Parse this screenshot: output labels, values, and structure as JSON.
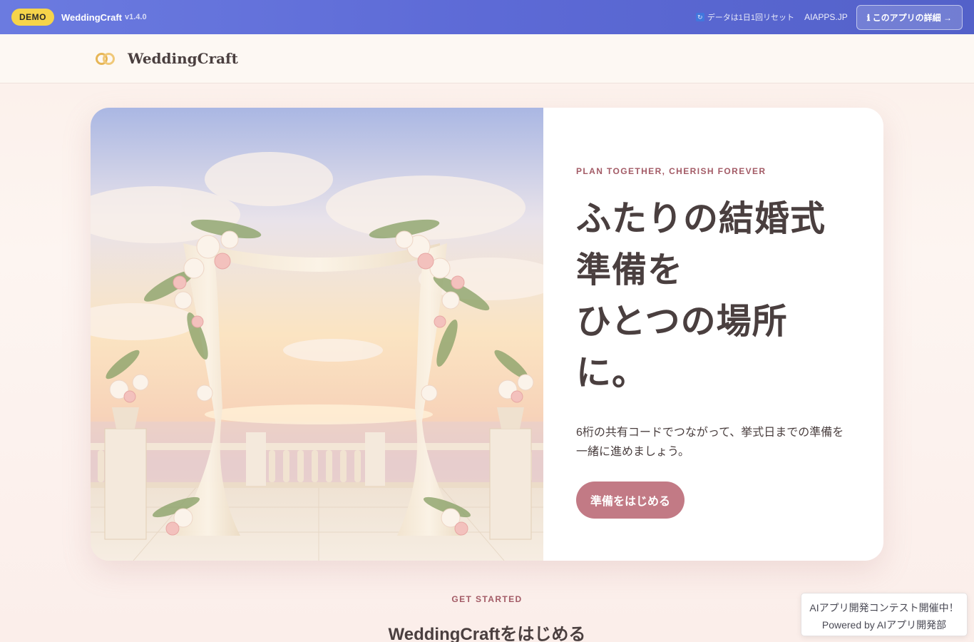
{
  "demo_bar": {
    "badge": "DEMO",
    "app_name": "WeddingCraft",
    "version": "v1.4.0",
    "reset_note": "データは1日1回リセット",
    "site_link": "AIAPPS.JP",
    "detail_button": "ℹ このアプリの詳細 →"
  },
  "header": {
    "brand": "WeddingCraft"
  },
  "hero": {
    "tagline": "PLAN TOGETHER, CHERISH FOREVER",
    "title_lines": [
      "ふたりの結婚式",
      "準備を",
      "ひとつの場所",
      "に。"
    ],
    "description": "6桁の共有コードでつながって、挙式日までの準備を一緒に進めましょう。",
    "cta": "準備をはじめる"
  },
  "get_started": {
    "label": "GET STARTED",
    "title": "WeddingCraftをはじめる"
  },
  "contest": {
    "line1": "AIアプリ開発コンテスト開催中！",
    "line2": "Powered by AIアプリ開発部"
  }
}
